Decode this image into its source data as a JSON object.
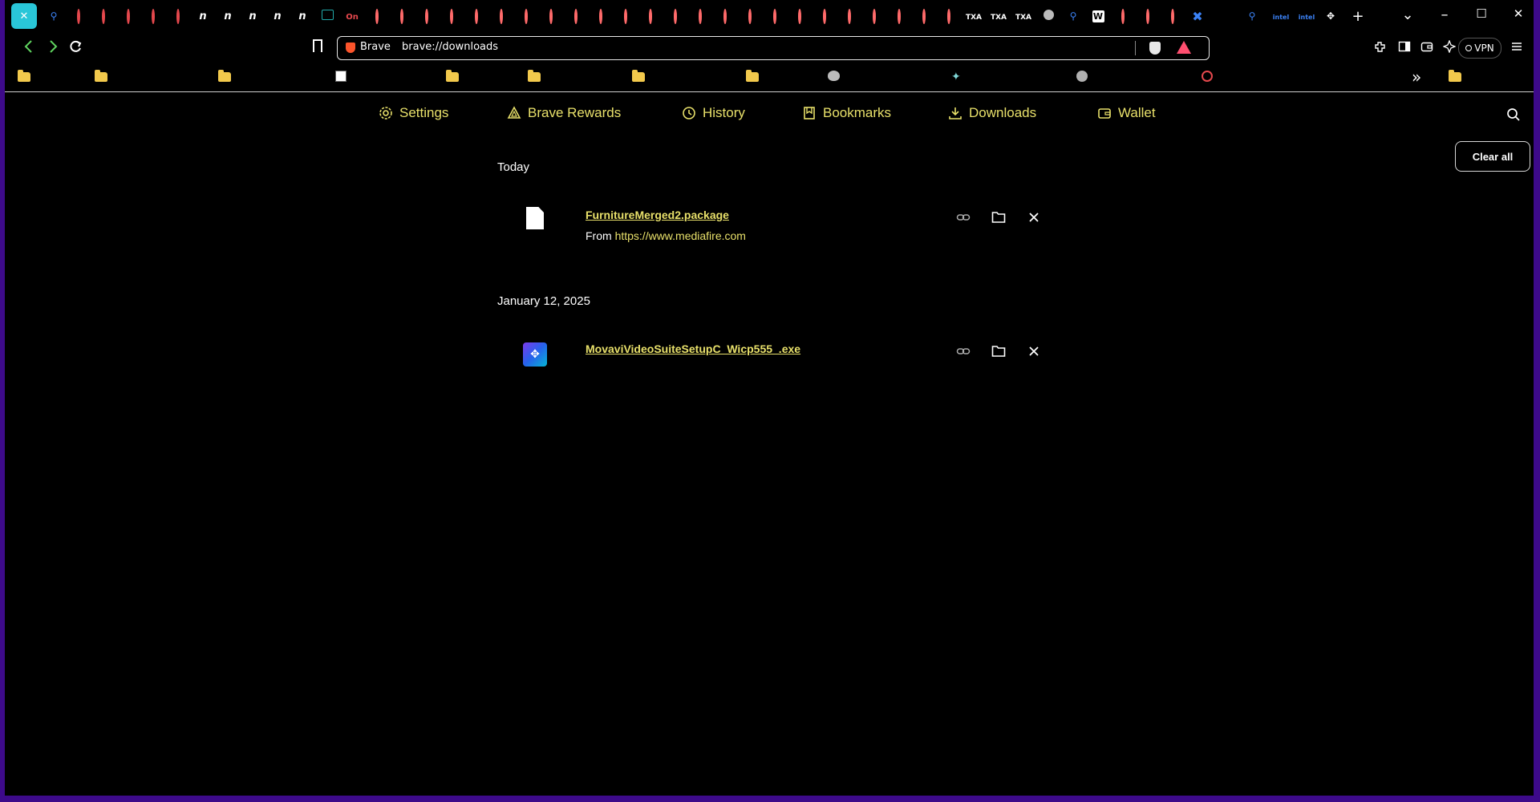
{
  "window": {
    "controls": {
      "dropdown": "⌄",
      "minimize": "–",
      "maximize": "☐",
      "close": "✕"
    }
  },
  "tabs": [
    {
      "icon": "close-icon",
      "active": true
    },
    {
      "icon": "search-icon"
    },
    {
      "icon": "red-circle-icon"
    },
    {
      "icon": "red-circle-icon"
    },
    {
      "icon": "red-circle-icon"
    },
    {
      "icon": "red-circle-icon"
    },
    {
      "icon": "red-circle-icon"
    },
    {
      "icon": "n-icon"
    },
    {
      "icon": "n-icon"
    },
    {
      "icon": "n-icon"
    },
    {
      "icon": "n-icon"
    },
    {
      "icon": "n-icon"
    },
    {
      "icon": "dark-square-icon"
    },
    {
      "icon": "om-icon"
    },
    {
      "icon": "fire-icon"
    },
    {
      "icon": "fire-icon"
    },
    {
      "icon": "fire-icon"
    },
    {
      "icon": "fire-icon"
    },
    {
      "icon": "fire-icon"
    },
    {
      "icon": "fire-icon"
    },
    {
      "icon": "fire-icon"
    },
    {
      "icon": "fire-icon"
    },
    {
      "icon": "fire-icon"
    },
    {
      "icon": "fire-icon"
    },
    {
      "icon": "fire-icon"
    },
    {
      "icon": "fire-icon"
    },
    {
      "icon": "fire-icon"
    },
    {
      "icon": "fire-icon"
    },
    {
      "icon": "fire-icon"
    },
    {
      "icon": "fire-icon"
    },
    {
      "icon": "fire-icon"
    },
    {
      "icon": "fire-icon"
    },
    {
      "icon": "fire-icon"
    },
    {
      "icon": "fire-icon"
    },
    {
      "icon": "fire-icon"
    },
    {
      "icon": "fire-icon"
    },
    {
      "icon": "fire-icon"
    },
    {
      "icon": "fire-icon"
    },
    {
      "icon": "tx-icon"
    },
    {
      "icon": "tx-icon"
    },
    {
      "icon": "tx-icon"
    },
    {
      "icon": "globe-icon"
    },
    {
      "icon": "search-icon"
    },
    {
      "icon": "w-icon"
    },
    {
      "icon": "fire-icon"
    },
    {
      "icon": "fire-icon"
    },
    {
      "icon": "fire-icon"
    },
    {
      "icon": "x-icon"
    },
    {
      "icon": "search-icon"
    },
    {
      "icon": "intel-icon"
    },
    {
      "icon": "intel-icon"
    },
    {
      "icon": "dots-icon"
    },
    {
      "icon": "new-tab-icon"
    }
  ],
  "toolbar": {
    "brand_label": "Brave",
    "url": "brave://downloads",
    "vpn_label": "VPN"
  },
  "bookmarks": [
    {
      "icon": "folder-icon"
    },
    {
      "icon": "folder-icon"
    },
    {
      "icon": "folder-icon"
    },
    {
      "icon": "page-icon"
    },
    {
      "icon": "folder-icon"
    },
    {
      "icon": "folder-icon"
    },
    {
      "icon": "folder-icon"
    },
    {
      "icon": "folder-icon"
    },
    {
      "icon": "face-icon"
    },
    {
      "icon": "star-icon"
    },
    {
      "icon": "globe-icon"
    },
    {
      "icon": "red-circle-icon"
    },
    {
      "icon": "folder-icon"
    }
  ],
  "page_nav": {
    "settings": "Settings",
    "rewards": "Brave Rewards",
    "history": "History",
    "bookmarks": "Bookmarks",
    "downloads": "Downloads",
    "wallet": "Wallet"
  },
  "clear_all_label": "Clear all",
  "colors": {
    "accent": "#e8e06a",
    "background": "#000000",
    "frame": "#3d0a8a"
  },
  "groups": [
    {
      "date": "Today",
      "items": [
        {
          "name": "FurnitureMerged2.package",
          "from_label": "From",
          "source": "https://www.mediafire.com",
          "icon": "file-icon"
        }
      ]
    },
    {
      "date": "January 12, 2025",
      "items": [
        {
          "name": "MovaviVideoSuiteSetupC_Wicp555_.exe",
          "icon": "movavi-icon"
        }
      ]
    }
  ]
}
